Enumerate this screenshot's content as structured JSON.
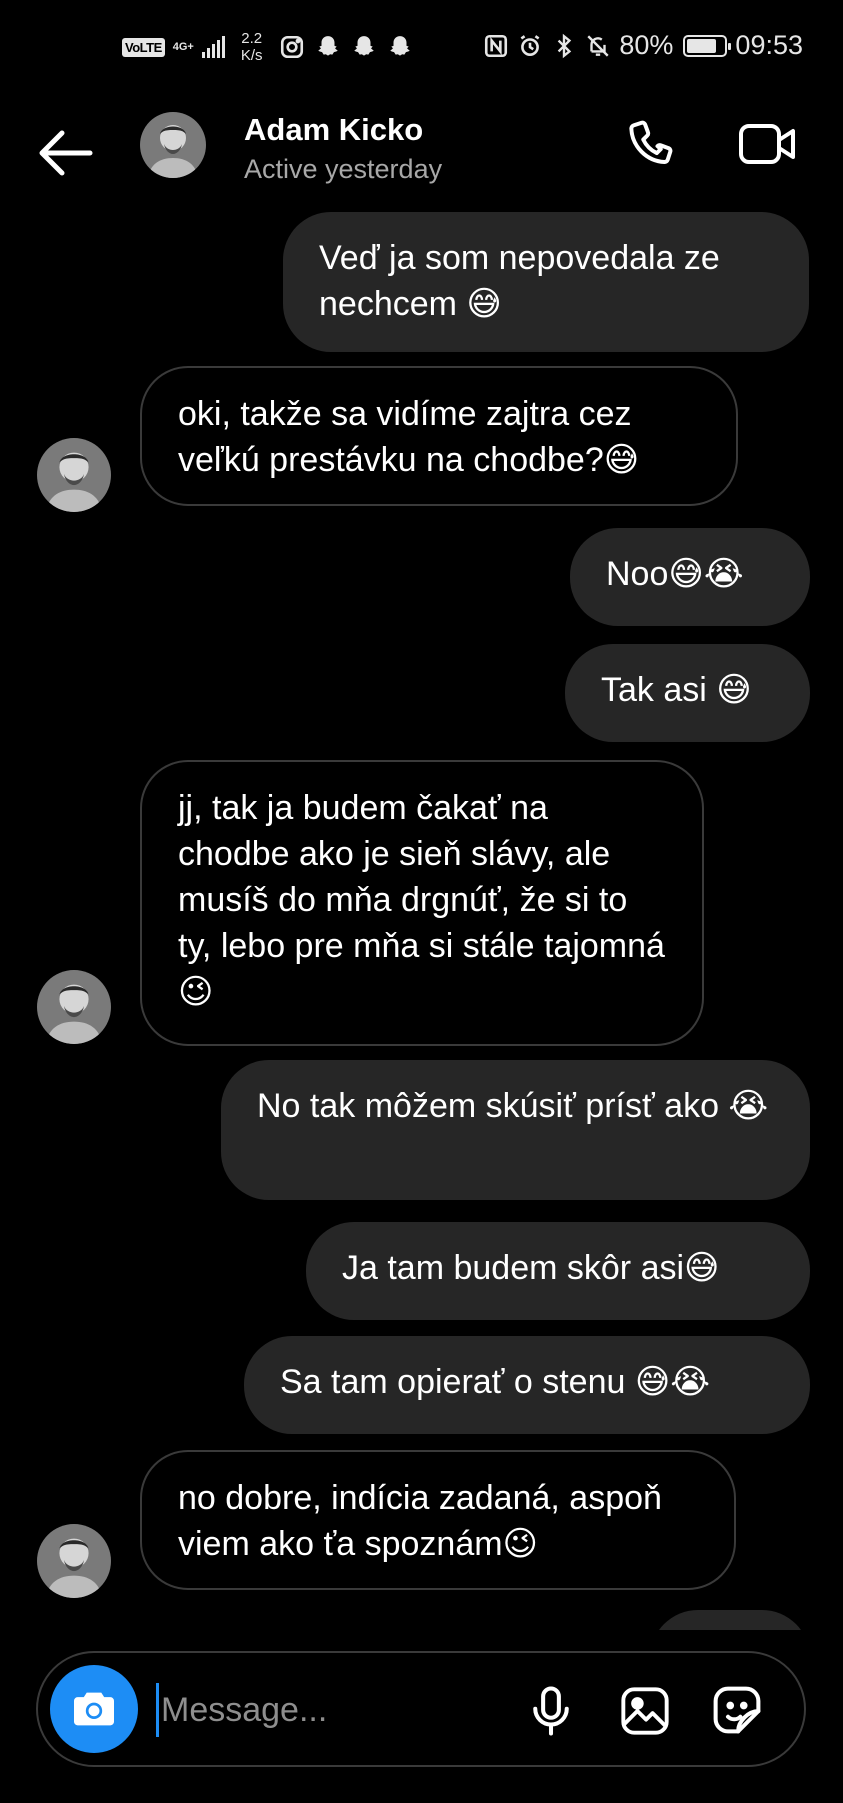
{
  "status_bar": {
    "volte": "VoLTE",
    "network": "4G+",
    "speed_value": "2.2",
    "speed_unit": "K/s",
    "battery": "80%",
    "battery_level": 0.8,
    "time": "09:53",
    "icons": [
      "instagram-icon",
      "snapchat-icon",
      "snapchat-icon",
      "snapchat-icon",
      "nfc-icon",
      "alarm-icon",
      "bluetooth-icon",
      "mute-icon"
    ]
  },
  "header": {
    "name": "Adam Kicko",
    "status": "Active yesterday"
  },
  "messages": [
    {
      "dir": "out",
      "text": "Veď ja som nepovedala ze nechcem 😅"
    },
    {
      "dir": "in",
      "text": "oki, takže sa vidíme zajtra cez veľkú prestávku na chodbe?😅"
    },
    {
      "dir": "out",
      "text": "Noo😅😭"
    },
    {
      "dir": "out",
      "text": "Tak asi 😅"
    },
    {
      "dir": "in",
      "text": "jj, tak ja budem čakať na chodbe ako je sieň slávy, ale musíš do mňa drgnúť, že si to ty, lebo pre mňa si stále tajomná😉"
    },
    {
      "dir": "out",
      "text": "No tak môžem skúsiť prísť ako 😭"
    },
    {
      "dir": "out",
      "text": "Ja tam budem skôr asi😅"
    },
    {
      "dir": "out",
      "text": "Sa tam opierať o stenu 😅😭"
    },
    {
      "dir": "in",
      "text": "no dobre, indícia zadaná, aspoň viem ako ťa spoznám😉"
    }
  ],
  "composer": {
    "placeholder": "Message..."
  }
}
